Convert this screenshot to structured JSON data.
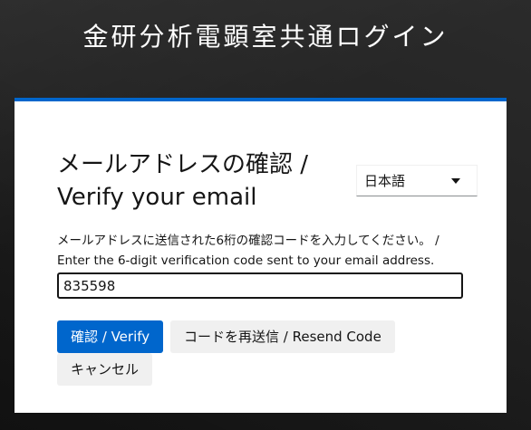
{
  "header": {
    "title": "金研分析電顕室共通ログイン"
  },
  "card": {
    "title_line1": "メールアドレスの確認 /",
    "title_line2": "Verify your email",
    "language_select": {
      "selected": "日本語"
    },
    "code_field": {
      "label_line1": "メールアドレスに送信された6桁の確認コードを入力してください。 /",
      "label_line2": "Enter the 6-digit verification code sent to your email address.",
      "value": "835598"
    },
    "buttons": {
      "verify": "確認 / Verify",
      "resend": "コードを再送信 / Resend Code",
      "cancel": "キャンセル"
    }
  },
  "colors": {
    "accent": "#0066cc",
    "background": "#1c1c1c",
    "button_secondary": "#f0f0f0",
    "text": "#151515"
  }
}
